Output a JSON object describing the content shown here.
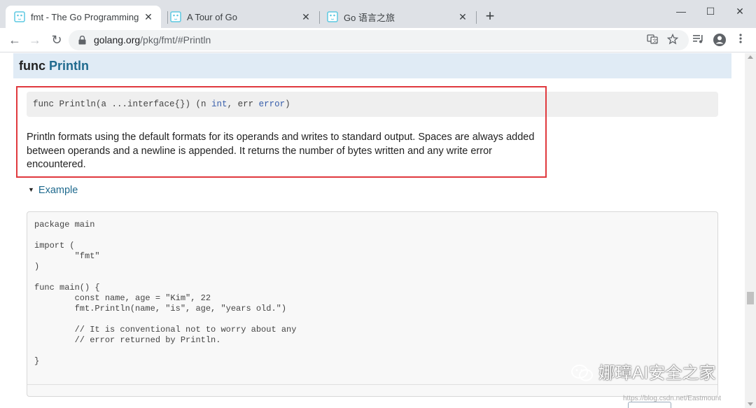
{
  "browser": {
    "tabs": [
      {
        "title": "fmt - The Go Programming La",
        "close": "✕",
        "active": true
      },
      {
        "title": "A Tour of Go",
        "close": "✕",
        "active": false
      },
      {
        "title": "Go 语言之旅",
        "close": "✕",
        "active": false
      }
    ],
    "new_tab": "+",
    "window_controls": {
      "minimize": "—",
      "maximize": "☐",
      "close": "✕"
    },
    "nav": {
      "back": "←",
      "forward": "→",
      "reload": "↻"
    },
    "url": {
      "host": "golang.org",
      "path": "/pkg/fmt/#Println"
    },
    "icons": {
      "translate": "translate-icon",
      "bookmark": "star-icon",
      "media": "media-control-icon",
      "profile": "profile-icon",
      "menu": "kebab-menu-icon"
    }
  },
  "doc": {
    "header": {
      "keyword": "func",
      "name": "Println"
    },
    "signature": {
      "prefix": "func Println(a ...interface{}) (n ",
      "type1": "int",
      "middle": ", err ",
      "type2": "error",
      "suffix": ")"
    },
    "description": "Println formats using the default formats for its operands and writes to standard output. Spaces are always added between operands and a newline is appended. It returns the number of bytes written and any write error encountered.",
    "example": {
      "toggle_label": "Example",
      "code": "package main\n\nimport (\n\t\"fmt\"\n)\n\nfunc main() {\n\tconst name, age = \"Kim\", 22\n\tfmt.Println(name, \"is\", age, \"years old.\")\n\n\t// It is conventional not to worry about any\n\t// error returned by Println.\n\n}"
    }
  },
  "watermark": {
    "text": "娜璋AI安全之家",
    "url_text": "https://blog.csdn.net/Eastmount"
  },
  "colors": {
    "highlight_border": "#e0393e",
    "link": "#1f6a8e",
    "header_bg": "#e0ebf5"
  }
}
